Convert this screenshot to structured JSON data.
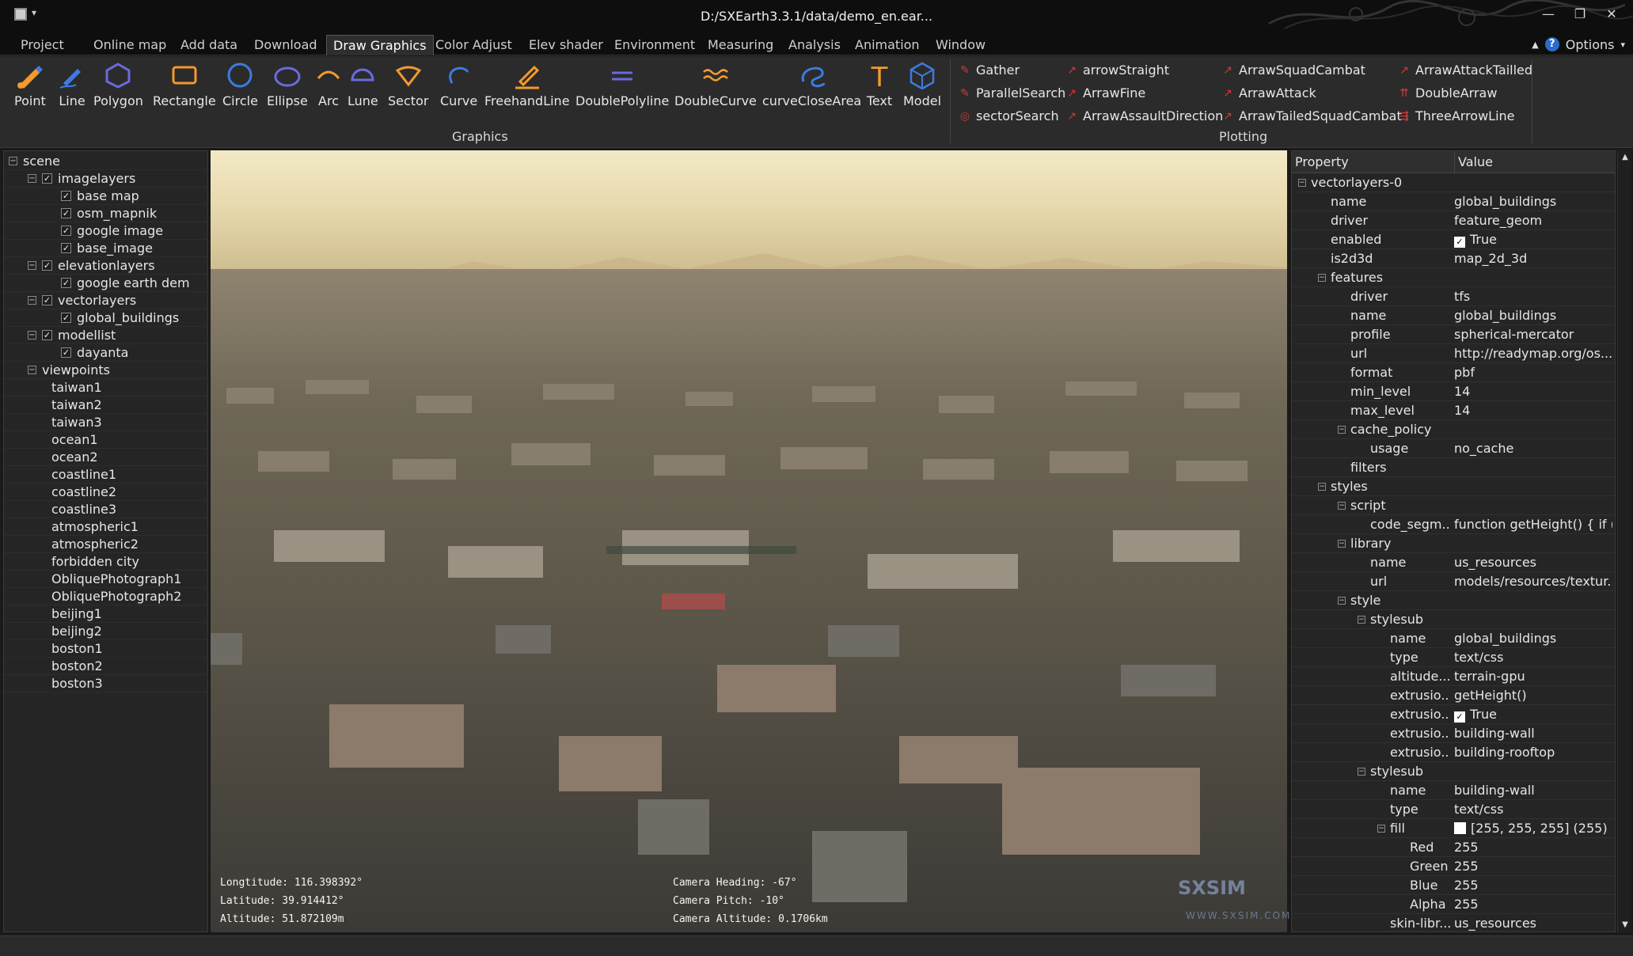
{
  "window": {
    "title": "D:/SXEarth3.3.1/data/demo_en.ear...",
    "minimize": "—",
    "maximize": "❐",
    "close": "✕"
  },
  "menu": {
    "tabs": [
      "Project",
      "Online map",
      "Add data",
      "Download",
      "Draw Graphics",
      "Color Adjust",
      "Elev shader",
      "Environment",
      "Measuring",
      "Analysis",
      "Animation",
      "Window"
    ],
    "active": "Draw Graphics",
    "help": "?",
    "options": "Options"
  },
  "ribbon": {
    "graphics_label": "Graphics",
    "plotting_label": "Plotting",
    "graphics": [
      {
        "label": "Point",
        "icon": "point-pen-icon"
      },
      {
        "label": "Line",
        "icon": "line-pen-icon"
      },
      {
        "label": "Polygon",
        "icon": "polygon-icon"
      },
      {
        "label": "Rectangle",
        "icon": "rectangle-icon"
      },
      {
        "label": "Circle",
        "icon": "circle-icon"
      },
      {
        "label": "Ellipse",
        "icon": "ellipse-icon"
      },
      {
        "label": "Arc",
        "icon": "arc-icon"
      },
      {
        "label": "Lune",
        "icon": "lune-icon"
      },
      {
        "label": "Sector",
        "icon": "sector-icon"
      },
      {
        "label": "Curve",
        "icon": "curve-icon"
      },
      {
        "label": "FreehandLine",
        "icon": "freehand-icon"
      },
      {
        "label": "DoublePolyline",
        "icon": "double-polyline-icon"
      },
      {
        "label": "DoubleCurve",
        "icon": "double-curve-icon"
      },
      {
        "label": "curveCloseArea",
        "icon": "curve-close-area-icon"
      },
      {
        "label": "Text",
        "icon": "text-icon"
      },
      {
        "label": "Model",
        "icon": "model-icon"
      }
    ],
    "plotting": [
      "Gather",
      "ParallelSearch",
      "sectorSearch",
      "arrowStraight",
      "ArrawFine",
      "ArrawAssaultDirection",
      "ArrawSquadCambat",
      "ArrawAttack",
      "ArrawTailedSquadCambat",
      "ArrawAttackTailled",
      "DoubleArraw",
      "ThreeArrowLine"
    ]
  },
  "scene_tree": [
    {
      "label": "scene",
      "level": 0,
      "expand": "minus",
      "check": false
    },
    {
      "label": "imagelayers",
      "level": 1,
      "expand": "minus",
      "check": true
    },
    {
      "label": "base map",
      "level": 2,
      "expand": "",
      "check": true
    },
    {
      "label": "osm_mapnik",
      "level": 2,
      "expand": "",
      "check": true
    },
    {
      "label": "google image",
      "level": 2,
      "expand": "",
      "check": true
    },
    {
      "label": "base_image",
      "level": 2,
      "expand": "",
      "check": true
    },
    {
      "label": "elevationlayers",
      "level": 1,
      "expand": "minus",
      "check": true
    },
    {
      "label": "google earth dem",
      "level": 2,
      "expand": "",
      "check": true
    },
    {
      "label": "vectorlayers",
      "level": 1,
      "expand": "minus",
      "check": true
    },
    {
      "label": "global_buildings",
      "level": 2,
      "expand": "",
      "check": true
    },
    {
      "label": "modellist",
      "level": 1,
      "expand": "minus",
      "check": true
    },
    {
      "label": "dayanta",
      "level": 2,
      "expand": "",
      "check": true
    },
    {
      "label": "viewpoints",
      "level": 1,
      "expand": "minus",
      "check": false
    },
    {
      "label": "taiwan1",
      "level": 2,
      "expand": "",
      "check": false
    },
    {
      "label": "taiwan2",
      "level": 2,
      "expand": "",
      "check": false
    },
    {
      "label": "taiwan3",
      "level": 2,
      "expand": "",
      "check": false
    },
    {
      "label": "ocean1",
      "level": 2,
      "expand": "",
      "check": false
    },
    {
      "label": "ocean2",
      "level": 2,
      "expand": "",
      "check": false
    },
    {
      "label": "coastline1",
      "level": 2,
      "expand": "",
      "check": false
    },
    {
      "label": "coastline2",
      "level": 2,
      "expand": "",
      "check": false
    },
    {
      "label": "coastline3",
      "level": 2,
      "expand": "",
      "check": false
    },
    {
      "label": "atmospheric1",
      "level": 2,
      "expand": "",
      "check": false
    },
    {
      "label": "atmospheric2",
      "level": 2,
      "expand": "",
      "check": false
    },
    {
      "label": "forbidden city",
      "level": 2,
      "expand": "",
      "check": false
    },
    {
      "label": "ObliquePhotograph1",
      "level": 2,
      "expand": "",
      "check": false
    },
    {
      "label": "ObliquePhotograph2",
      "level": 2,
      "expand": "",
      "check": false
    },
    {
      "label": "beijing1",
      "level": 2,
      "expand": "",
      "check": false
    },
    {
      "label": "beijing2",
      "level": 2,
      "expand": "",
      "check": false
    },
    {
      "label": "boston1",
      "level": 2,
      "expand": "",
      "check": false
    },
    {
      "label": "boston2",
      "level": 2,
      "expand": "",
      "check": false
    },
    {
      "label": "boston3",
      "level": 2,
      "expand": "",
      "check": false
    }
  ],
  "viewport": {
    "longitude_label": "Longtitude:",
    "longitude": "116.398392°",
    "latitude_label": "Latitude:",
    "latitude": "39.914412°",
    "altitude_label": "Altitude:",
    "altitude": "51.872109m",
    "heading_label": "Camera Heading:",
    "heading": "-67°",
    "pitch_label": "Camera Pitch:",
    "pitch": "-10°",
    "cam_alt_label": "Camera Altitude:",
    "cam_alt": "0.1706km",
    "watermark": "SXSIM",
    "watermark_url": "WWW.SXSIM.COM"
  },
  "properties": {
    "col_property": "Property",
    "col_value": "Value",
    "rows": [
      {
        "name": "vectorlayers-0",
        "value": "",
        "level": 0,
        "expand": "minus"
      },
      {
        "name": "name",
        "value": "global_buildings",
        "level": 1,
        "expand": ""
      },
      {
        "name": "driver",
        "value": "feature_geom",
        "level": 1,
        "expand": ""
      },
      {
        "name": "enabled",
        "value": "True",
        "level": 1,
        "expand": "",
        "check": true
      },
      {
        "name": "is2d3d",
        "value": "map_2d_3d",
        "level": 1,
        "expand": ""
      },
      {
        "name": "features",
        "value": "",
        "level": 1,
        "expand": "minus"
      },
      {
        "name": "driver",
        "value": "tfs",
        "level": 2,
        "expand": ""
      },
      {
        "name": "name",
        "value": "global_buildings",
        "level": 2,
        "expand": ""
      },
      {
        "name": "profile",
        "value": "spherical-mercator",
        "level": 2,
        "expand": ""
      },
      {
        "name": "url",
        "value": "http://readymap.org/os...",
        "level": 2,
        "expand": ""
      },
      {
        "name": "format",
        "value": "pbf",
        "level": 2,
        "expand": ""
      },
      {
        "name": "min_level",
        "value": "14",
        "level": 2,
        "expand": ""
      },
      {
        "name": "max_level",
        "value": "14",
        "level": 2,
        "expand": ""
      },
      {
        "name": "cache_policy",
        "value": "",
        "level": 2,
        "expand": "minus"
      },
      {
        "name": "usage",
        "value": "no_cache",
        "level": 3,
        "expand": ""
      },
      {
        "name": "filters",
        "value": "",
        "level": 2,
        "expand": ""
      },
      {
        "name": "styles",
        "value": "",
        "level": 1,
        "expand": "minus"
      },
      {
        "name": "script",
        "value": "",
        "level": 2,
        "expand": "minus"
      },
      {
        "name": "code_segm...",
        "value": "function getHeight() { if (...",
        "level": 3,
        "expand": ""
      },
      {
        "name": "library",
        "value": "",
        "level": 2,
        "expand": "minus"
      },
      {
        "name": "name",
        "value": "us_resources",
        "level": 3,
        "expand": ""
      },
      {
        "name": "url",
        "value": "models/resources/textur...",
        "level": 3,
        "expand": ""
      },
      {
        "name": "style",
        "value": "",
        "level": 2,
        "expand": "minus"
      },
      {
        "name": "stylesub",
        "value": "",
        "level": 3,
        "expand": "minus"
      },
      {
        "name": "name",
        "value": "global_buildings",
        "level": 4,
        "expand": ""
      },
      {
        "name": "type",
        "value": "text/css",
        "level": 4,
        "expand": ""
      },
      {
        "name": "altitude...",
        "value": "terrain-gpu",
        "level": 4,
        "expand": ""
      },
      {
        "name": "extrusio...",
        "value": "getHeight()",
        "level": 4,
        "expand": ""
      },
      {
        "name": "extrusio...",
        "value": "True",
        "level": 4,
        "expand": "",
        "check": true
      },
      {
        "name": "extrusio...",
        "value": "building-wall",
        "level": 4,
        "expand": ""
      },
      {
        "name": "extrusio...",
        "value": "building-rooftop",
        "level": 4,
        "expand": ""
      },
      {
        "name": "stylesub",
        "value": "",
        "level": 3,
        "expand": "minus"
      },
      {
        "name": "name",
        "value": "building-wall",
        "level": 4,
        "expand": ""
      },
      {
        "name": "type",
        "value": "text/css",
        "level": 4,
        "expand": ""
      },
      {
        "name": "fill",
        "value": "[255, 255, 255] (255)",
        "level": 4,
        "expand": "minus",
        "swatch": true
      },
      {
        "name": "Red",
        "value": "255",
        "level": 5,
        "expand": ""
      },
      {
        "name": "Green",
        "value": "255",
        "level": 5,
        "expand": ""
      },
      {
        "name": "Blue",
        "value": "255",
        "level": 5,
        "expand": ""
      },
      {
        "name": "Alpha",
        "value": "255",
        "level": 5,
        "expand": ""
      },
      {
        "name": "skin-libr...",
        "value": "us_resources",
        "level": 4,
        "expand": ""
      }
    ]
  },
  "colors": {
    "accent_orange": "#f29a2e",
    "accent_blue": "#3d7be0",
    "plot_red": "#d23b3b"
  }
}
